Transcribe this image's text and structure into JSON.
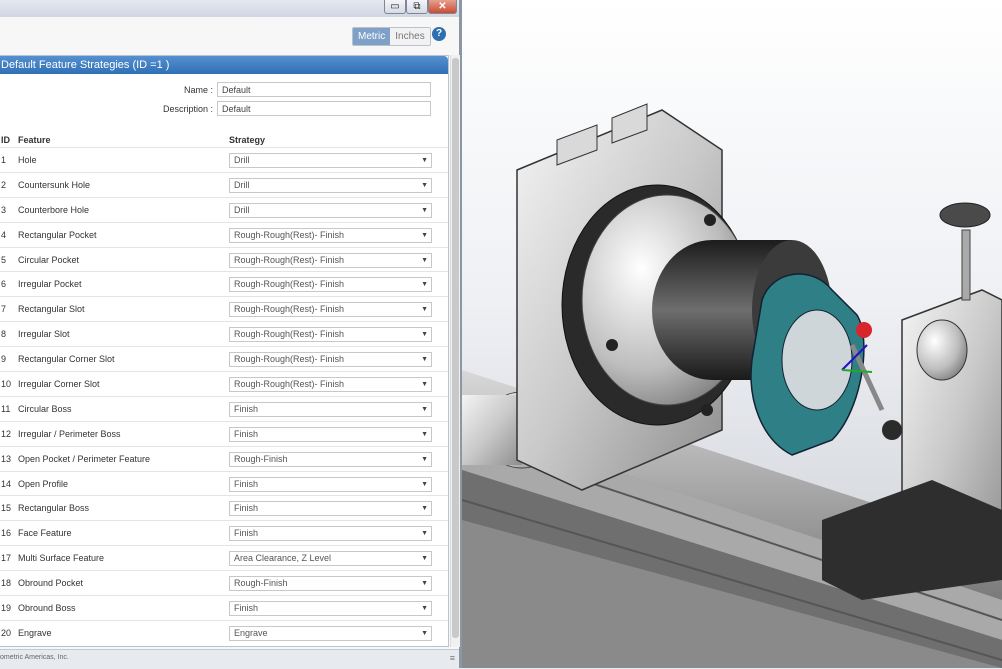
{
  "window": {
    "controls": {
      "minimize": "▭",
      "maximize": "⧉",
      "close": "✕"
    }
  },
  "toolbar": {
    "units": [
      "Metric",
      "Inches"
    ],
    "active_unit": "Metric",
    "help": "?"
  },
  "panel": {
    "title": "Default Feature Strategies (ID =1 )",
    "name_label": "Name :",
    "name_value": "Default",
    "description_label": "Description :",
    "description_value": "Default"
  },
  "table": {
    "headers": {
      "id": "ID",
      "feature": "Feature",
      "strategy": "Strategy"
    },
    "rows": [
      {
        "id": "1",
        "feature": "Hole",
        "strategy": "Drill"
      },
      {
        "id": "2",
        "feature": "Countersunk Hole",
        "strategy": "Drill"
      },
      {
        "id": "3",
        "feature": "Counterbore Hole",
        "strategy": "Drill"
      },
      {
        "id": "4",
        "feature": "Rectangular Pocket",
        "strategy": "Rough-Rough(Rest)- Finish"
      },
      {
        "id": "5",
        "feature": "Circular Pocket",
        "strategy": "Rough-Rough(Rest)- Finish"
      },
      {
        "id": "6",
        "feature": "Irregular Pocket",
        "strategy": "Rough-Rough(Rest)- Finish"
      },
      {
        "id": "7",
        "feature": "Rectangular Slot",
        "strategy": "Rough-Rough(Rest)- Finish"
      },
      {
        "id": "8",
        "feature": "Irregular Slot",
        "strategy": "Rough-Rough(Rest)- Finish"
      },
      {
        "id": "9",
        "feature": "Rectangular Corner Slot",
        "strategy": "Rough-Rough(Rest)- Finish"
      },
      {
        "id": "10",
        "feature": "Irregular Corner Slot",
        "strategy": "Rough-Rough(Rest)- Finish"
      },
      {
        "id": "11",
        "feature": "Circular Boss",
        "strategy": "Finish"
      },
      {
        "id": "12",
        "feature": "Irregular / Perimeter Boss",
        "strategy": "Finish"
      },
      {
        "id": "13",
        "feature": "Open Pocket / Perimeter Feature",
        "strategy": "Rough-Finish"
      },
      {
        "id": "14",
        "feature": "Open Profile",
        "strategy": "Finish"
      },
      {
        "id": "15",
        "feature": "Rectangular Boss",
        "strategy": "Finish"
      },
      {
        "id": "16",
        "feature": "Face Feature",
        "strategy": "Finish"
      },
      {
        "id": "17",
        "feature": "Multi Surface Feature",
        "strategy": "Area Clearance, Z Level"
      },
      {
        "id": "18",
        "feature": "Obround Pocket",
        "strategy": "Rough-Finish"
      },
      {
        "id": "19",
        "feature": "Obround Boss",
        "strategy": "Finish"
      },
      {
        "id": "20",
        "feature": "Engrave",
        "strategy": "Engrave"
      }
    ]
  },
  "status": {
    "copyright": "ometric Americas, Inc."
  },
  "colors": {
    "accent": "#2f6fb4",
    "active_unit": "#7fa1c8",
    "part": "#2f7f86"
  }
}
